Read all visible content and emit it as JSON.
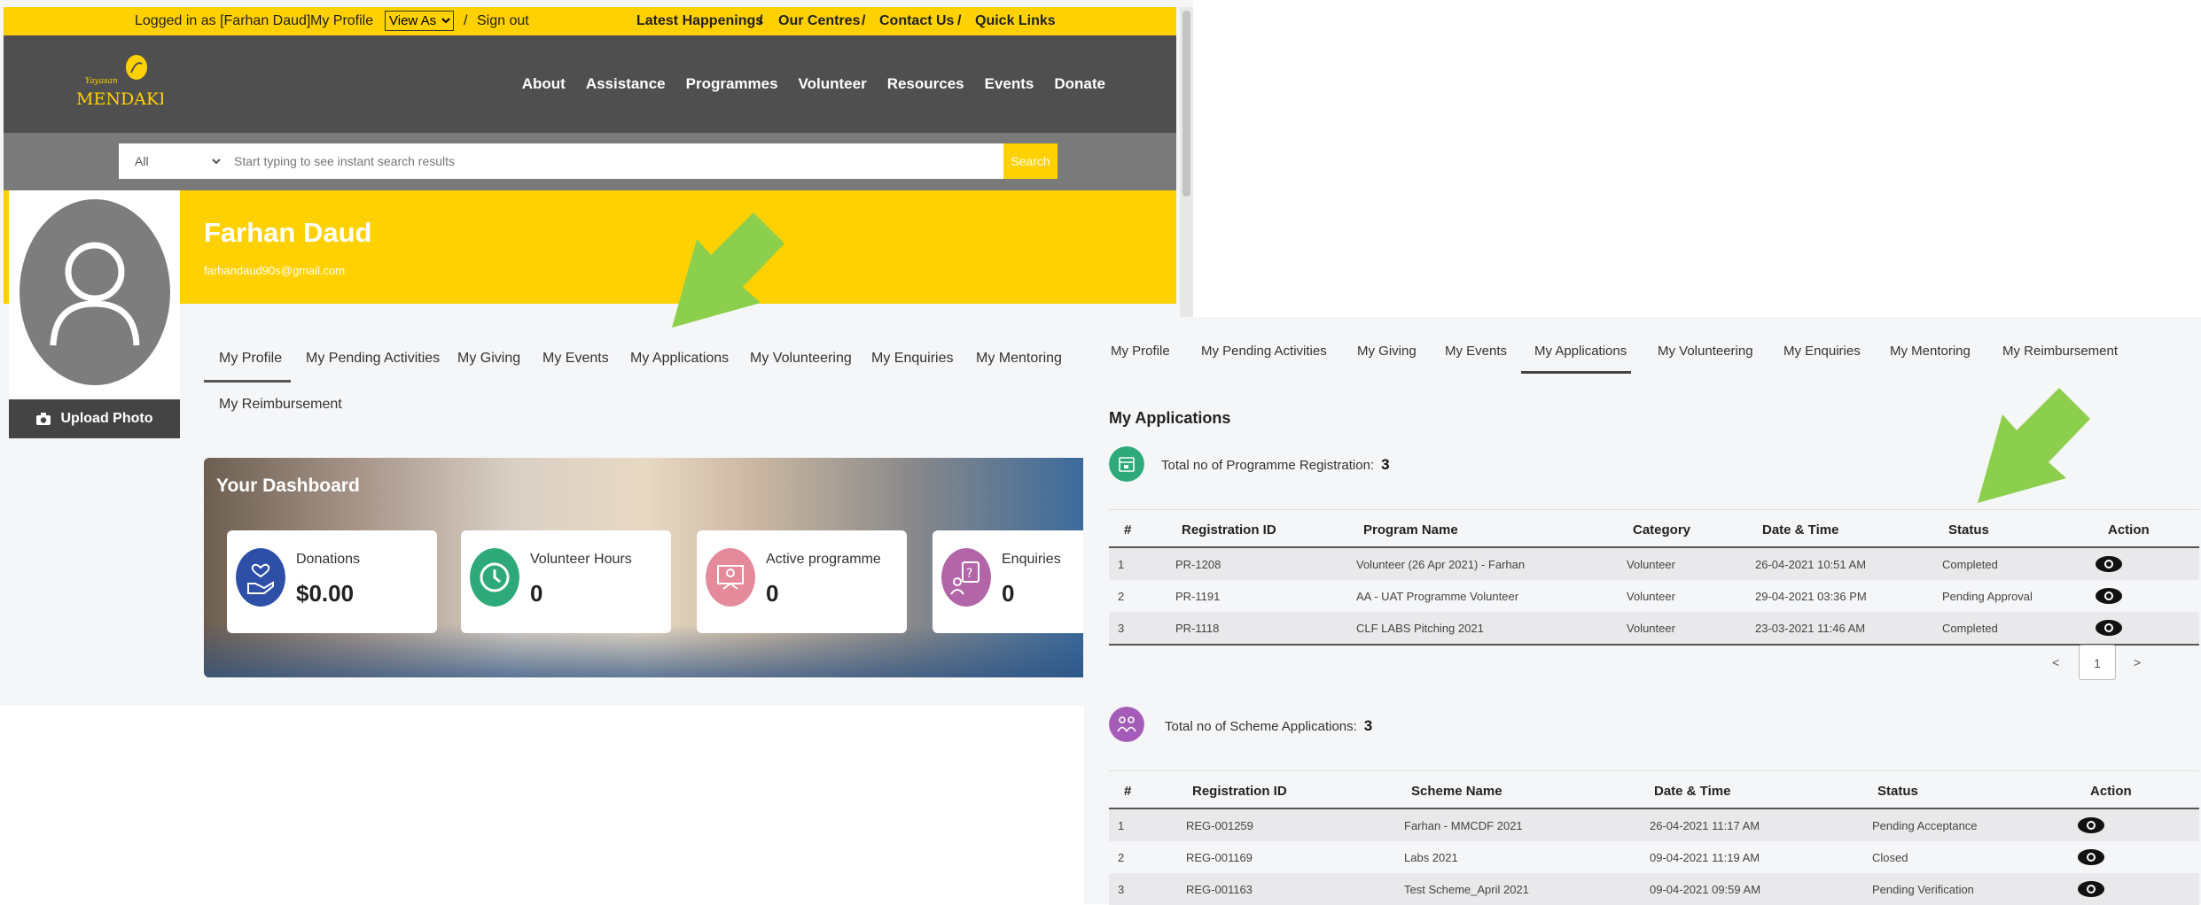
{
  "topbar": {
    "logged_in": "Logged in as [Farhan Daud]",
    "my_profile": "My Profile",
    "view_as": "View As",
    "sep": "/",
    "sign_out": "Sign out",
    "latest": "Latest Happenings",
    "centres": "Our Centres",
    "contact": "Contact Us",
    "quick": "Quick Links"
  },
  "logo_text": "MENDAKI",
  "mainnav": [
    "About",
    "Assistance",
    "Programmes",
    "Volunteer",
    "Resources",
    "Events",
    "Donate"
  ],
  "search": {
    "category": "All",
    "placeholder": "Start typing to see instant search results",
    "button": "Search"
  },
  "profile": {
    "name": "Farhan Daud",
    "email": "farhandaud90s@gmail.com",
    "upload": "Upload Photo"
  },
  "left_tabs": [
    "My Profile",
    "My Pending Activities",
    "My Giving",
    "My Events",
    "My Applications",
    "My Volunteering",
    "My Enquiries",
    "My Mentoring",
    "My Reimbursement"
  ],
  "dashboard": {
    "title": "Your Dashboard",
    "cards": [
      {
        "label": "Donations",
        "value": "$0.00",
        "color": "#2e4fa8",
        "icon": "donation-hand-icon"
      },
      {
        "label": "Volunteer Hours",
        "value": "0",
        "color": "#2eaa7a",
        "icon": "clock-icon"
      },
      {
        "label": "Active programme",
        "value": "0",
        "color": "#e58a9b",
        "icon": "programme-board-icon"
      },
      {
        "label": "Enquiries",
        "value": "0",
        "color": "#b266a8",
        "icon": "question-person-icon"
      }
    ]
  },
  "right_tabs": [
    "My Profile",
    "My Pending Activities",
    "My Giving",
    "My Events",
    "My Applications",
    "My Volunteering",
    "My Enquiries",
    "My Mentoring",
    "My Reimbursement"
  ],
  "applications": {
    "title": "My Applications",
    "programme": {
      "label": "Total no of Programme Registration:",
      "count": "3",
      "headers": [
        "#",
        "Registration ID",
        "Program Name",
        "Category",
        "Date & Time",
        "Status",
        "Action"
      ],
      "rows": [
        {
          "n": "1",
          "id": "PR-1208",
          "name": "Volunteer (26 Apr 2021) - Farhan",
          "cat": "Volunteer",
          "dt": "26-04-2021 10:51 AM",
          "status": "Completed"
        },
        {
          "n": "2",
          "id": "PR-1191",
          "name": "AA - UAT Programme Volunteer",
          "cat": "Volunteer",
          "dt": "29-04-2021 03:36 PM",
          "status": "Pending Approval"
        },
        {
          "n": "3",
          "id": "PR-1118",
          "name": "CLF LABS Pitching 2021",
          "cat": "Volunteer",
          "dt": "23-03-2021 11:46 AM",
          "status": "Completed"
        }
      ],
      "pager": {
        "prev": "<",
        "page": "1",
        "next": ">"
      }
    },
    "scheme": {
      "label": "Total no of Scheme Applications:",
      "count": "3",
      "headers": [
        "#",
        "Registration ID",
        "Scheme Name",
        "Date & Time",
        "Status",
        "Action"
      ],
      "rows": [
        {
          "n": "1",
          "id": "REG-001259",
          "name": "Farhan - MMCDF 2021",
          "dt": "26-04-2021 11:17 AM",
          "status": "Pending Acceptance"
        },
        {
          "n": "2",
          "id": "REG-001169",
          "name": "Labs 2021",
          "dt": "09-04-2021 11:19 AM",
          "status": "Closed"
        },
        {
          "n": "3",
          "id": "REG-001163",
          "name": "Test Scheme_April 2021",
          "dt": "09-04-2021 09:59 AM",
          "status": "Pending Verification"
        }
      ]
    }
  },
  "colors": {
    "yellow": "#ffd100",
    "header": "#4f4f4f",
    "arrow": "#8ccf4d",
    "programme_badge": "#2eaa7a",
    "scheme_badge": "#a45cb8"
  }
}
